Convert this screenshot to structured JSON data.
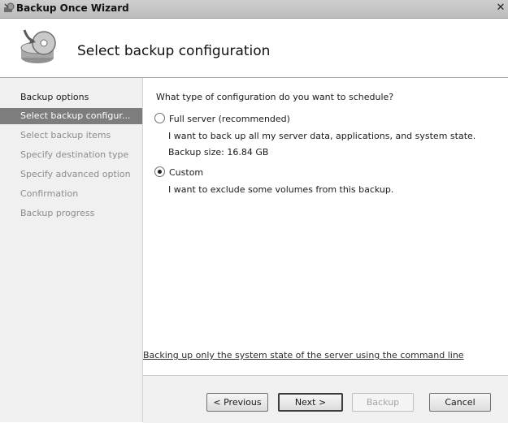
{
  "window": {
    "title": "Backup Once Wizard",
    "close_glyph": "✕"
  },
  "header": {
    "title": "Select backup configuration",
    "icon": "backup-disk-icon"
  },
  "nav": {
    "items": [
      {
        "label": "Backup options",
        "state": "done"
      },
      {
        "label": "Select backup configur...",
        "state": "current"
      },
      {
        "label": "Select backup items",
        "state": "future"
      },
      {
        "label": "Specify destination type",
        "state": "future"
      },
      {
        "label": "Specify advanced option",
        "state": "future"
      },
      {
        "label": "Confirmation",
        "state": "future"
      },
      {
        "label": "Backup progress",
        "state": "future"
      }
    ]
  },
  "main": {
    "question": "What type of configuration do you want to schedule?",
    "options": [
      {
        "label": "Full server (recommended)",
        "selected": false,
        "description": "I want to back up all my server data, applications, and system state.",
        "extra": "Backup size: 16.84 GB"
      },
      {
        "label": "Custom",
        "selected": true,
        "description": "I want to exclude some volumes from this backup."
      }
    ],
    "link": "Backing up only the system state of the server using the command line"
  },
  "footer": {
    "previous": "< Previous",
    "next": "Next >",
    "backup": "Backup",
    "cancel": "Cancel"
  }
}
